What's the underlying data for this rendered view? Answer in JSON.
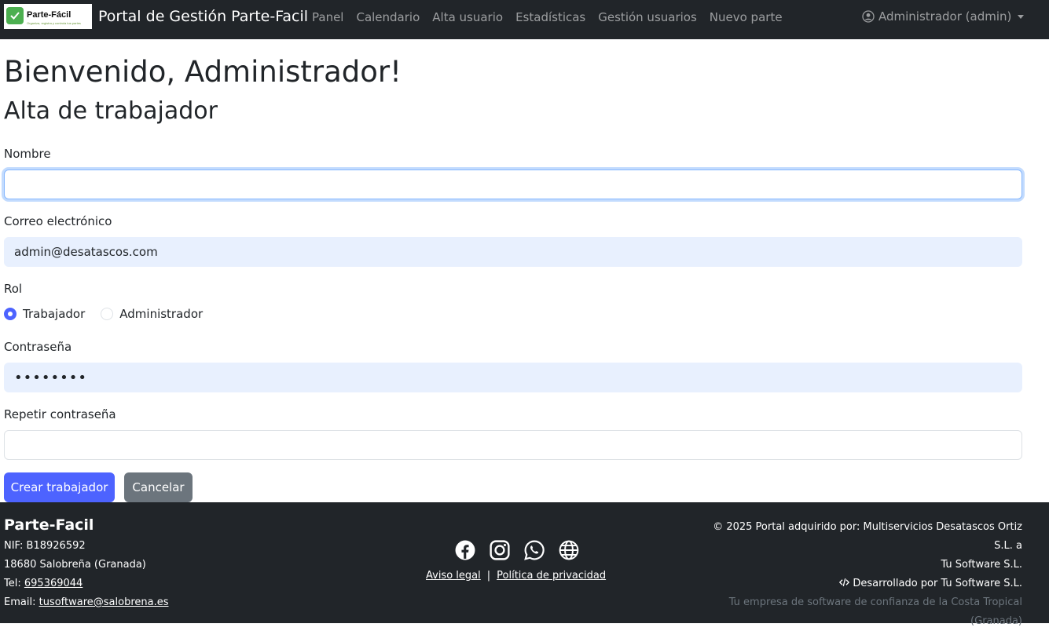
{
  "navbar": {
    "logo_name": "Parte-Fácil",
    "logo_tag": "Organiza, registra y controla tus partes",
    "brand": "Portal de Gestión Parte-Facil",
    "links": [
      "Panel",
      "Calendario",
      "Alta usuario",
      "Estadísticas",
      "Gestión usuarios",
      "Nuevo parte"
    ],
    "user": "Administrador (admin)"
  },
  "main": {
    "welcome": "Bienvenido, Administrador!",
    "form_title": "Alta de trabajador",
    "fields": {
      "name_label": "Nombre",
      "name_value": "",
      "email_label": "Correo electrónico",
      "email_value": "admin@desatascos.com",
      "role_label": "Rol",
      "role_options": [
        "Trabajador",
        "Administrador"
      ],
      "role_selected": "Trabajador",
      "password_label": "Contraseña",
      "password_value": "••••••••",
      "repeat_label": "Repetir contraseña",
      "repeat_value": ""
    },
    "buttons": {
      "create": "Crear trabajador",
      "cancel": "Cancelar"
    }
  },
  "footer": {
    "brand": "Parte-Facil",
    "nif": "NIF: B18926592",
    "address": "18680 Salobreña (Granada)",
    "tel_label": "Tel:",
    "tel": "695369044",
    "email_label": "Email:",
    "email": "tusoftware@salobrena.es",
    "social_icons": [
      "facebook-icon",
      "instagram-icon",
      "whatsapp-icon",
      "globe-icon"
    ],
    "legal_link": "Aviso legal",
    "privacy_link": "Política de privacidad",
    "copyright_line1": "© 2025 Portal adquirido por: Multiservicios Desatascos Ortiz S.L. a",
    "copyright_line2": "Tu Software S.L.",
    "developed": "Desarrollado por Tu Software S.L.",
    "tagline_line1": "Tu empresa de software de confianza de la Costa Tropical",
    "tagline_line2": "(Granada)"
  },
  "colors": {
    "navbar_bg": "#212529",
    "primary": "#4d63ff",
    "secondary": "#6c757d",
    "autofill_bg": "#e8f0fe"
  }
}
